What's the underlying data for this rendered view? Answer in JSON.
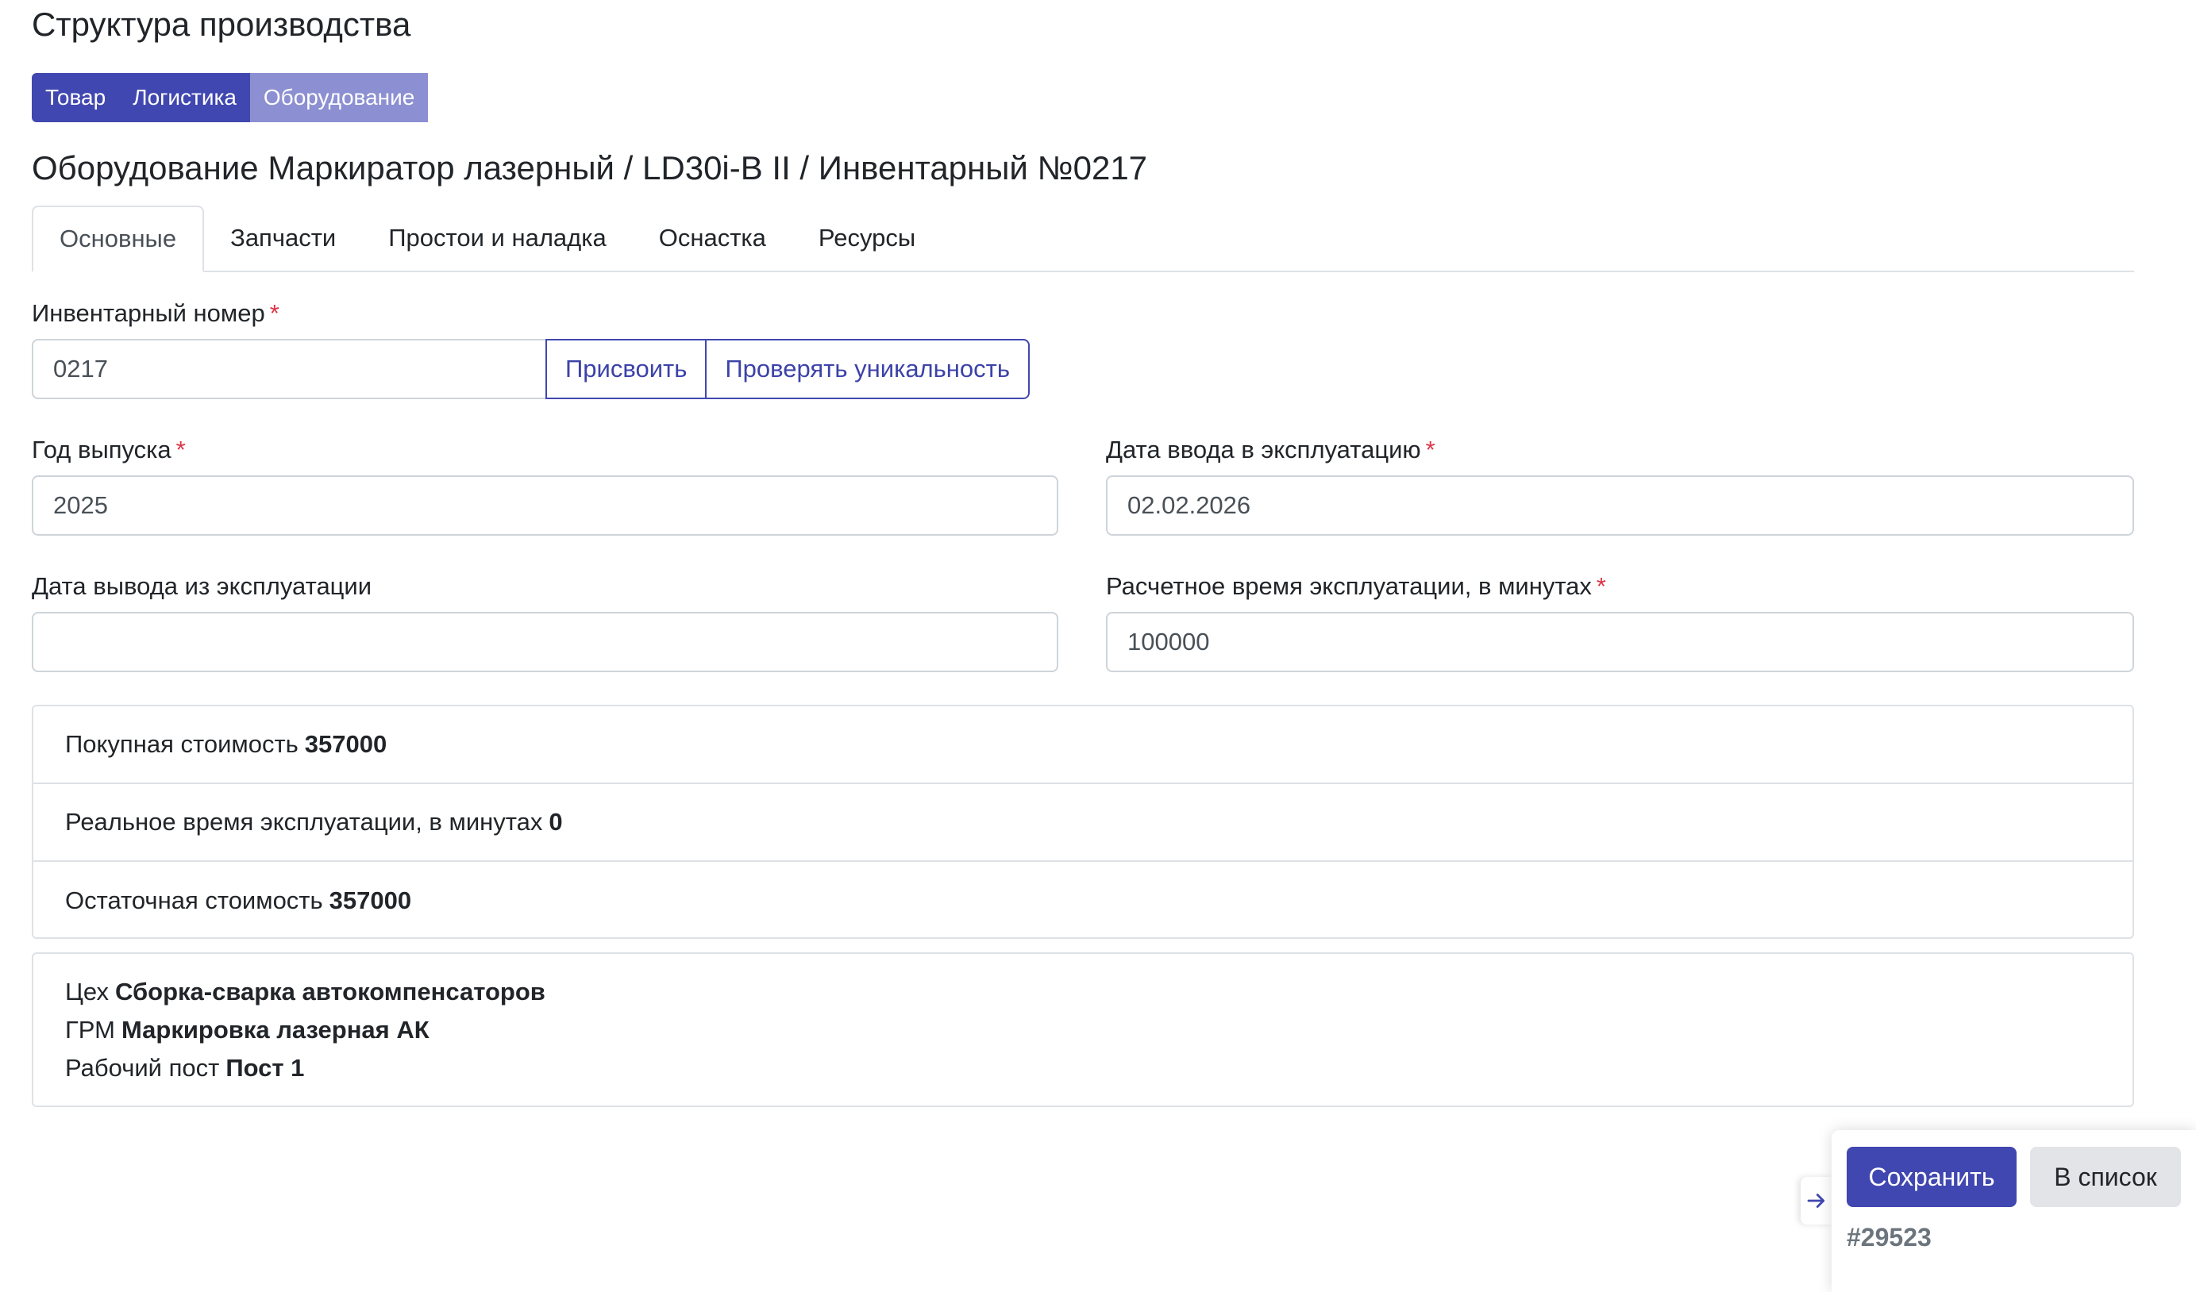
{
  "page": {
    "title": "Структура производства"
  },
  "section_nav": [
    {
      "label": "Товар",
      "active": false
    },
    {
      "label": "Логистика",
      "active": false
    },
    {
      "label": "Оборудование",
      "active": true
    }
  ],
  "equipment": {
    "title": "Оборудование Маркиратор лазерный / LD30i-B II / Инвентарный №0217"
  },
  "tabs": [
    {
      "label": "Основные",
      "active": true
    },
    {
      "label": "Запчасти",
      "active": false
    },
    {
      "label": "Простои и наладка",
      "active": false
    },
    {
      "label": "Оснастка",
      "active": false
    },
    {
      "label": "Ресурсы",
      "active": false
    }
  ],
  "form": {
    "inventory_number": {
      "label": "Инвентарный номер",
      "required_mark": "*",
      "value": "0217",
      "assign_button": "Присвоить",
      "check_button": "Проверять уникальность"
    },
    "year": {
      "label": "Год выпуска",
      "required_mark": "*",
      "value": "2025"
    },
    "commission_date": {
      "label": "Дата ввода в эксплуатацию",
      "required_mark": "*",
      "value": "02.02.2026"
    },
    "decommission_date": {
      "label": "Дата вывода из эксплуатации",
      "value": ""
    },
    "estimated_time": {
      "label": "Расчетное время эксплуатации, в минутах",
      "required_mark": "*",
      "value": "100000"
    }
  },
  "stats": [
    {
      "label": "Покупная стоимость",
      "value": "357000"
    },
    {
      "label": "Реальное время эксплуатации, в минутах",
      "value": "0"
    },
    {
      "label": "Остаточная стоимость",
      "value": "357000"
    }
  ],
  "location": [
    {
      "label": "Цех",
      "value": "Сборка-сварка автокомпенсаторов"
    },
    {
      "label": "ГРМ",
      "value": "Маркировка лазерная АК"
    },
    {
      "label": "Рабочий пост",
      "value": "Пост 1"
    }
  ],
  "actions": {
    "save_label": "Сохранить",
    "list_label": "В список",
    "record_id": "#29523",
    "toggle_icon": "arrow-right-icon"
  },
  "colors": {
    "primary": "#4147b0",
    "active_nav": "#8c8fd1",
    "required": "#dc3545"
  }
}
